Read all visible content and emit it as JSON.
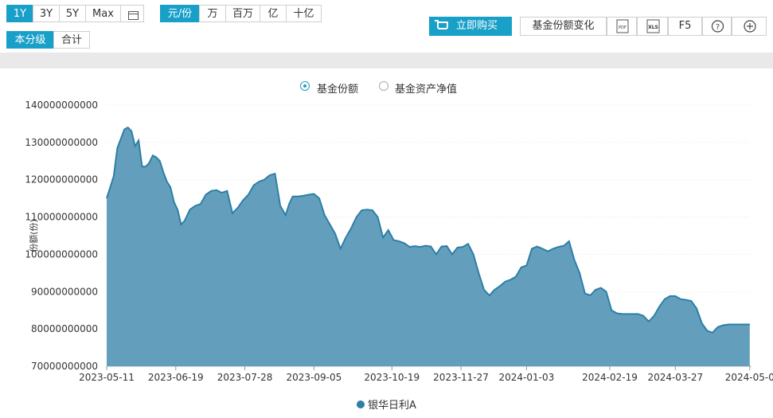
{
  "range_tabs": [
    "1Y",
    "3Y",
    "5Y",
    "Max"
  ],
  "active_range": "1Y",
  "unit_tabs": [
    "元/份",
    "万",
    "百万",
    "亿",
    "十亿"
  ],
  "active_unit": "元/份",
  "share_tabs": [
    "本分级",
    "合计"
  ],
  "active_share": "本分级",
  "buy_label": "立即购买",
  "tools": {
    "share_change": "基金份额变化",
    "pdf": "PDF",
    "xls": "XLS",
    "f5": "F5",
    "help": "?",
    "add": "⊕"
  },
  "toggles": [
    {
      "label": "基金份额",
      "selected": true
    },
    {
      "label": "基金资产净值",
      "selected": false
    }
  ],
  "colors": {
    "accent": "#19a0c8",
    "area": "#5b9ab9",
    "line": "#2c7fa6"
  },
  "chart_data": {
    "type": "area",
    "title": "",
    "xlabel": "",
    "ylabel": "份额(份)",
    "ylim": [
      70000000000,
      140000000000
    ],
    "yticks": [
      70000000000,
      80000000000,
      90000000000,
      100000000000,
      110000000000,
      120000000000,
      130000000000,
      140000000000
    ],
    "ytick_labels": [
      "70000000000",
      "80000000000",
      "90000000000",
      "100000000000",
      "110000000000",
      "120000000000",
      "130000000000",
      "140000000000"
    ],
    "xticks": [
      "2023-05-11",
      "2023-06-19",
      "2023-07-28",
      "2023-09-05",
      "2023-10-19",
      "2023-11-27",
      "2024-01-03",
      "2024-02-19",
      "2024-03-27",
      "2024-05-0"
    ],
    "grid": true,
    "legend": "bottom",
    "series": [
      {
        "name": "银华日利A",
        "x": [
          "2023-05-11",
          "2023-05-13",
          "2023-05-15",
          "2023-05-17",
          "2023-05-19",
          "2023-05-21",
          "2023-05-23",
          "2023-05-25",
          "2023-05-27",
          "2023-05-29",
          "2023-05-31",
          "2023-06-02",
          "2023-06-04",
          "2023-06-06",
          "2023-06-08",
          "2023-06-10",
          "2023-06-12",
          "2023-06-14",
          "2023-06-16",
          "2023-06-18",
          "2023-06-20",
          "2023-06-22",
          "2023-06-24",
          "2023-06-27",
          "2023-06-30",
          "2023-07-03",
          "2023-07-06",
          "2023-07-09",
          "2023-07-12",
          "2023-07-15",
          "2023-07-18",
          "2023-07-21",
          "2023-07-24",
          "2023-07-27",
          "2023-07-30",
          "2023-08-02",
          "2023-08-05",
          "2023-08-08",
          "2023-08-11",
          "2023-08-14",
          "2023-08-17",
          "2023-08-20",
          "2023-08-22",
          "2023-08-24",
          "2023-08-27",
          "2023-08-30",
          "2023-09-02",
          "2023-09-05",
          "2023-09-08",
          "2023-09-11",
          "2023-09-14",
          "2023-09-17",
          "2023-09-20",
          "2023-09-23",
          "2023-09-26",
          "2023-09-29",
          "2023-10-02",
          "2023-10-05",
          "2023-10-08",
          "2023-10-11",
          "2023-10-14",
          "2023-10-17",
          "2023-10-20",
          "2023-10-23",
          "2023-10-26",
          "2023-10-29",
          "2023-11-01",
          "2023-11-04",
          "2023-11-07",
          "2023-11-10",
          "2023-11-13",
          "2023-11-16",
          "2023-11-19",
          "2023-11-22",
          "2023-11-25",
          "2023-11-28",
          "2023-12-01",
          "2023-12-04",
          "2023-12-07",
          "2023-12-10",
          "2023-12-13",
          "2023-12-16",
          "2023-12-19",
          "2023-12-22",
          "2023-12-25",
          "2023-12-28",
          "2023-12-31",
          "2024-01-03",
          "2024-01-06",
          "2024-01-09",
          "2024-01-12",
          "2024-01-15",
          "2024-01-18",
          "2024-01-21",
          "2024-01-24",
          "2024-01-27",
          "2024-01-30",
          "2024-02-02",
          "2024-02-05",
          "2024-02-08",
          "2024-02-11",
          "2024-02-14",
          "2024-02-17",
          "2024-02-20",
          "2024-02-23",
          "2024-02-26",
          "2024-02-29",
          "2024-03-03",
          "2024-03-06",
          "2024-03-09",
          "2024-03-12",
          "2024-03-15",
          "2024-03-18",
          "2024-03-21",
          "2024-03-24",
          "2024-03-27",
          "2024-03-30",
          "2024-04-02",
          "2024-04-05",
          "2024-04-08",
          "2024-04-11",
          "2024-04-14",
          "2024-04-17",
          "2024-04-20",
          "2024-04-23",
          "2024-04-26",
          "2024-04-29",
          "2024-05-02",
          "2024-05-05",
          "2024-05-08"
        ],
        "values": [
          115000000000,
          118000000000,
          121000000000,
          128500000000,
          131000000000,
          133500000000,
          134000000000,
          133000000000,
          129000000000,
          130500000000,
          123500000000,
          123500000000,
          124500000000,
          126500000000,
          126000000000,
          125000000000,
          122000000000,
          119500000000,
          118000000000,
          114000000000,
          112000000000,
          108000000000,
          109000000000,
          112000000000,
          113000000000,
          113500000000,
          116000000000,
          117000000000,
          117200000000,
          116500000000,
          117000000000,
          111000000000,
          112500000000,
          114500000000,
          116000000000,
          118500000000,
          119500000000,
          120000000000,
          121200000000,
          121600000000,
          113000000000,
          110500000000,
          113500000000,
          115500000000,
          115500000000,
          115700000000,
          116000000000,
          116200000000,
          115000000000,
          110500000000,
          108000000000,
          105500000000,
          101500000000,
          104500000000,
          107000000000,
          110000000000,
          111800000000,
          112000000000,
          111800000000,
          110000000000,
          104500000000,
          106500000000,
          103800000000,
          103500000000,
          103000000000,
          102000000000,
          102200000000,
          102000000000,
          102300000000,
          102100000000,
          100000000000,
          102100000000,
          102200000000,
          100000000000,
          101800000000,
          102000000000,
          102800000000,
          100000000000,
          95000000000,
          90500000000,
          89000000000,
          90500000000,
          91500000000,
          92700000000,
          93200000000,
          94000000000,
          96500000000,
          97000000000,
          101500000000,
          102100000000,
          101500000000,
          100800000000,
          101500000000,
          102000000000,
          102300000000,
          103500000000,
          98500000000,
          95000000000,
          89500000000,
          89000000000,
          90500000000,
          91000000000,
          90000000000,
          85000000000,
          84200000000,
          84000000000,
          84000000000,
          84000000000,
          84000000000,
          83500000000,
          82000000000,
          83500000000,
          86000000000,
          88000000000,
          88800000000,
          88800000000,
          88000000000,
          87800000000,
          87500000000,
          85500000000,
          81500000000,
          79500000000,
          79000000000,
          80500000000,
          81000000000,
          81200000000,
          81200000000,
          81200000000,
          81200000000,
          81200000000
        ]
      }
    ]
  }
}
